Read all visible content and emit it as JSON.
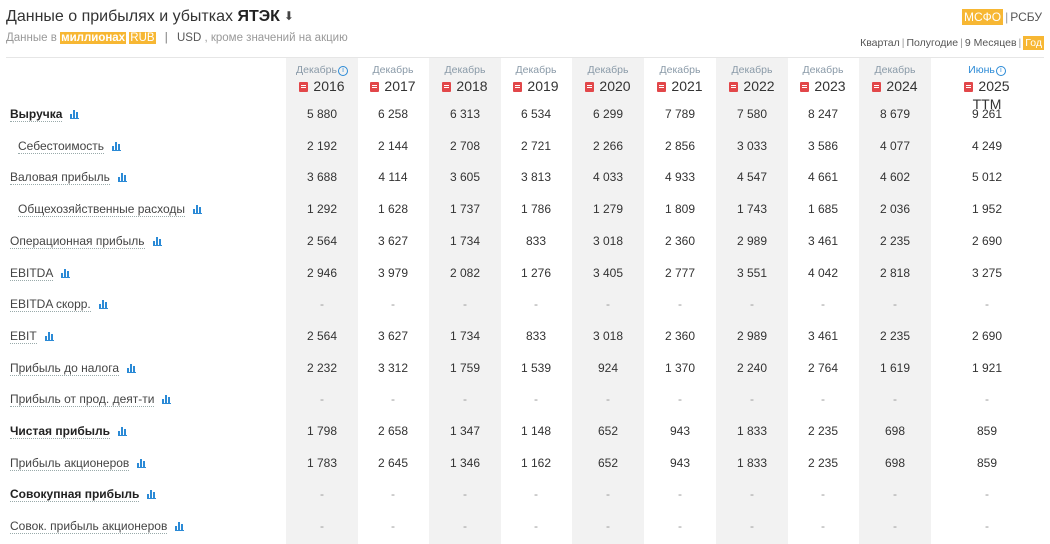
{
  "header": {
    "title_prefix": "Данные о прибылях и убытках",
    "ticker": "ЯТЭК",
    "download_icon": "download-icon",
    "units_prefix": "Данные в",
    "units_scale": "миллионах",
    "currency_rub": "RUB",
    "separator": "|",
    "currency_usd": "USD",
    "units_suffix": ", кроме значений на акцию"
  },
  "standards": {
    "ifrs": "МСФО",
    "separator": "|",
    "ras": "РСБУ"
  },
  "periods": {
    "quarter": "Квартал",
    "half": "Полугодие",
    "nine_months": "9 Месяцев",
    "year": "Год",
    "separator": "|"
  },
  "columns": [
    {
      "month": "Декабрь",
      "year": "2016",
      "info": true
    },
    {
      "month": "Декабрь",
      "year": "2017"
    },
    {
      "month": "Декабрь",
      "year": "2018"
    },
    {
      "month": "Декабрь",
      "year": "2019"
    },
    {
      "month": "Декабрь",
      "year": "2020"
    },
    {
      "month": "Декабрь",
      "year": "2021"
    },
    {
      "month": "Декабрь",
      "year": "2022"
    },
    {
      "month": "Декабрь",
      "year": "2023"
    },
    {
      "month": "Декабрь",
      "year": "2024"
    },
    {
      "month": "Июнь",
      "year": "2025 TTM",
      "info": true
    }
  ],
  "rows": [
    {
      "label": "Выручка",
      "bold": true,
      "indent": false,
      "values": [
        "5 880",
        "6 258",
        "6 313",
        "6 534",
        "6 299",
        "7 789",
        "7 580",
        "8 247",
        "8 679",
        "9 261"
      ]
    },
    {
      "label": "Себестоимость",
      "bold": false,
      "indent": true,
      "values": [
        "2 192",
        "2 144",
        "2 708",
        "2 721",
        "2 266",
        "2 856",
        "3 033",
        "3 586",
        "4 077",
        "4 249"
      ]
    },
    {
      "label": "Валовая прибыль",
      "bold": false,
      "indent": false,
      "values": [
        "3 688",
        "4 114",
        "3 605",
        "3 813",
        "4 033",
        "4 933",
        "4 547",
        "4 661",
        "4 602",
        "5 012"
      ]
    },
    {
      "label": "Общехозяйственные расходы",
      "bold": false,
      "indent": true,
      "values": [
        "1 292",
        "1 628",
        "1 737",
        "1 786",
        "1 279",
        "1 809",
        "1 743",
        "1 685",
        "2 036",
        "1 952"
      ]
    },
    {
      "label": "Операционная прибыль",
      "bold": false,
      "indent": false,
      "values": [
        "2 564",
        "3 627",
        "1 734",
        "833",
        "3 018",
        "2 360",
        "2 989",
        "3 461",
        "2 235",
        "2 690"
      ]
    },
    {
      "label": "EBITDA",
      "bold": false,
      "indent": false,
      "values": [
        "2 946",
        "3 979",
        "2 082",
        "1 276",
        "3 405",
        "2 777",
        "3 551",
        "4 042",
        "2 818",
        "3 275"
      ]
    },
    {
      "label": "EBITDA скорр.",
      "bold": false,
      "indent": false,
      "values": [
        "-",
        "-",
        "-",
        "-",
        "-",
        "-",
        "-",
        "-",
        "-",
        "-"
      ]
    },
    {
      "label": "EBIT",
      "bold": false,
      "indent": false,
      "values": [
        "2 564",
        "3 627",
        "1 734",
        "833",
        "3 018",
        "2 360",
        "2 989",
        "3 461",
        "2 235",
        "2 690"
      ]
    },
    {
      "label": "Прибыль до налога",
      "bold": false,
      "indent": false,
      "values": [
        "2 232",
        "3 312",
        "1 759",
        "1 539",
        "924",
        "1 370",
        "2 240",
        "2 764",
        "1 619",
        "1 921"
      ]
    },
    {
      "label": "Прибыль от прод. деят-ти",
      "bold": false,
      "indent": false,
      "values": [
        "-",
        "-",
        "-",
        "-",
        "-",
        "-",
        "-",
        "-",
        "-",
        "-"
      ]
    },
    {
      "label": "Чистая прибыль",
      "bold": true,
      "indent": false,
      "values": [
        "1 798",
        "2 658",
        "1 347",
        "1 148",
        "652",
        "943",
        "1 833",
        "2 235",
        "698",
        "859"
      ]
    },
    {
      "label": "Прибыль акционеров",
      "bold": false,
      "indent": false,
      "values": [
        "1 783",
        "2 645",
        "1 346",
        "1 162",
        "652",
        "943",
        "1 833",
        "2 235",
        "698",
        "859"
      ]
    },
    {
      "label": "Совокупная прибыль",
      "bold": true,
      "indent": false,
      "values": [
        "-",
        "-",
        "-",
        "-",
        "-",
        "-",
        "-",
        "-",
        "-",
        "-"
      ]
    },
    {
      "label": "Совок. прибыль акционеров",
      "bold": false,
      "indent": false,
      "values": [
        "-",
        "-",
        "-",
        "-",
        "-",
        "-",
        "-",
        "-",
        "-",
        "-"
      ]
    }
  ],
  "colors": {
    "accent": "#f7b733",
    "link": "#2b8ad6",
    "pdf": "#e2474a",
    "stripe": "#f2f2f2"
  }
}
